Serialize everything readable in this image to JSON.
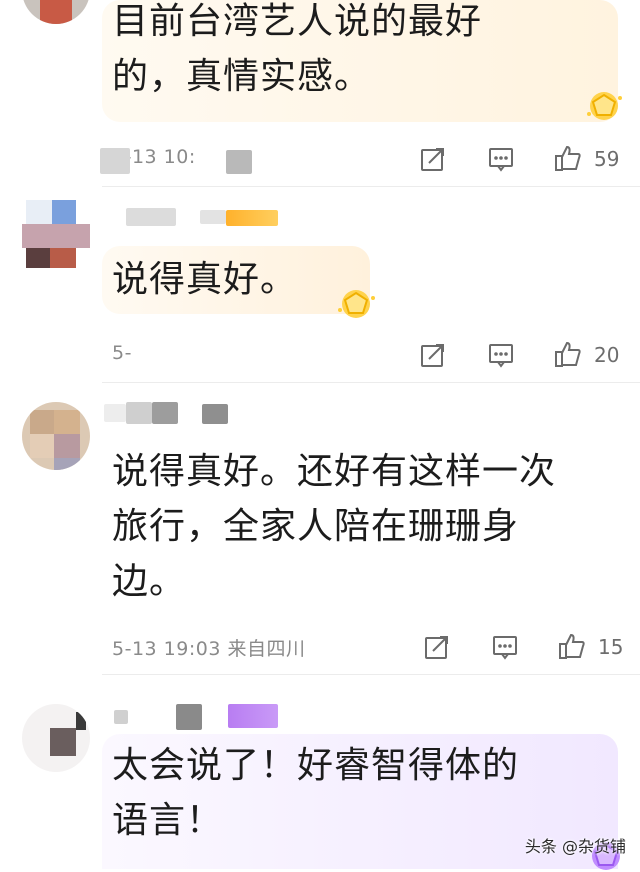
{
  "comments": [
    {
      "text": "目前台湾艺人说的最好\n的，真情实感。",
      "meta": "5-13 10:",
      "likes": "59"
    },
    {
      "text": "说得真好。",
      "meta": "5-",
      "likes": "20"
    },
    {
      "text": "说得真好。还好有这样一次\n旅行，全家人陪在珊珊身\n边。",
      "meta": "5-13 19:03 来自四川",
      "likes": "15"
    },
    {
      "text": "太会说了！好睿智得体的\n语言！",
      "meta": "",
      "likes": ""
    }
  ],
  "watermark": "头条 @杂货铺",
  "colors": {
    "bubble_gold": "#fff6e4",
    "bubble_purple": "#f3ecff",
    "meta_gray": "#8a8a8a"
  },
  "icons": [
    "share-icon",
    "reply-icon",
    "like-icon",
    "crown-badge-icon"
  ]
}
